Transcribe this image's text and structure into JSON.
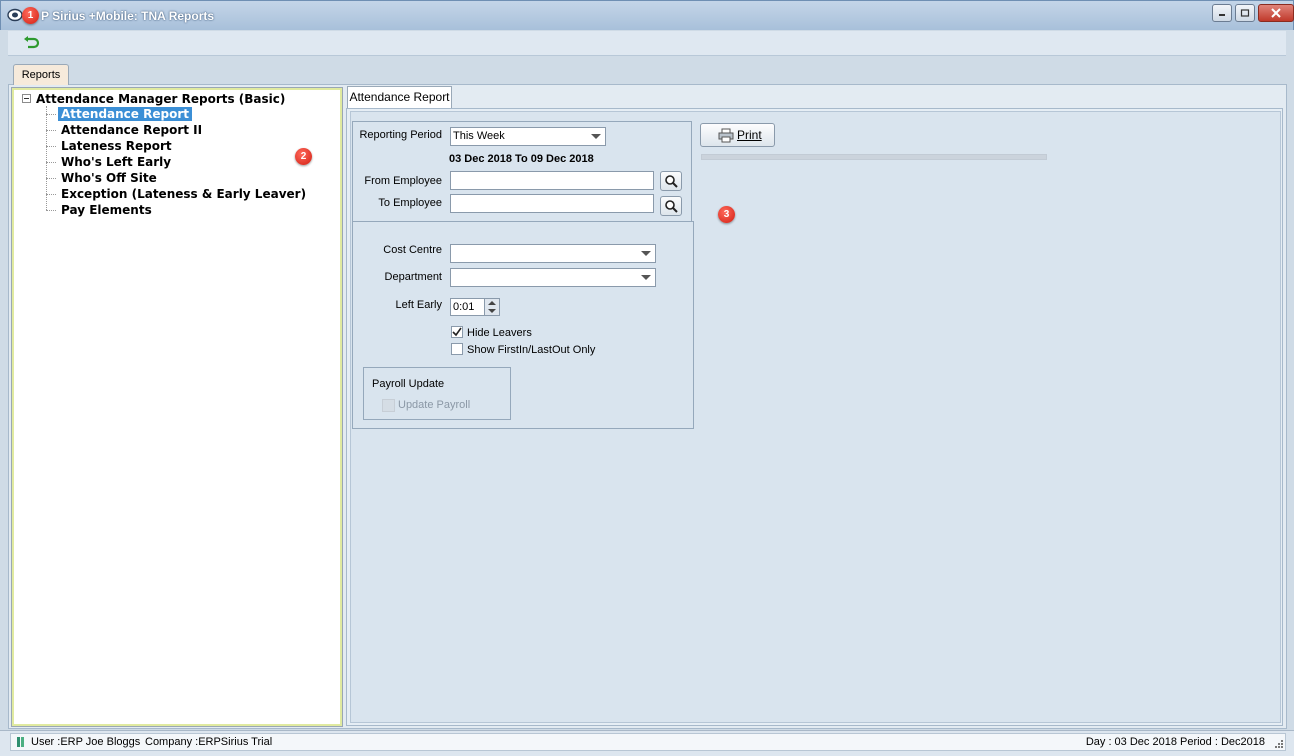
{
  "window": {
    "title": "P Sirius +Mobile: TNA Reports",
    "accent": "#a8c0da"
  },
  "badges": [
    "1",
    "2",
    "3"
  ],
  "outer_tab": {
    "label": "Reports"
  },
  "tree": {
    "root": "Attendance Manager Reports (Basic)",
    "items": [
      {
        "label": "Attendance Report",
        "selected": true
      },
      {
        "label": "Attendance Report II"
      },
      {
        "label": "Lateness Report"
      },
      {
        "label": "Who's Left Early"
      },
      {
        "label": "Who's Off Site"
      },
      {
        "label": "Exception (Lateness & Early Leaver)"
      },
      {
        "label": "Pay Elements"
      }
    ]
  },
  "report_tab": {
    "label": "Attendance Report"
  },
  "form": {
    "reporting_period_label": "Reporting Period",
    "reporting_period_value": "This Week",
    "date_range": "03 Dec 2018 To 09 Dec 2018",
    "from_employee_label": "From Employee",
    "from_employee_value": "",
    "to_employee_label": "To Employee",
    "to_employee_value": "",
    "cost_centre_label": "Cost Centre",
    "cost_centre_value": "",
    "department_label": "Department",
    "department_value": "",
    "left_early_label": "Left Early",
    "left_early_value": "0:01",
    "hide_leavers_label": "Hide Leavers",
    "hide_leavers_checked": true,
    "show_firstin_label": "Show FirstIn/LastOut Only",
    "show_firstin_checked": false,
    "payroll_update_title": "Payroll Update",
    "update_payroll_label": "Update Payroll"
  },
  "print_button": {
    "label": "Print"
  },
  "status": {
    "user": "User :ERP Joe Bloggs",
    "company": "Company :ERPSirius Trial",
    "day_period": "Day : 03 Dec 2018  Period : Dec2018"
  }
}
